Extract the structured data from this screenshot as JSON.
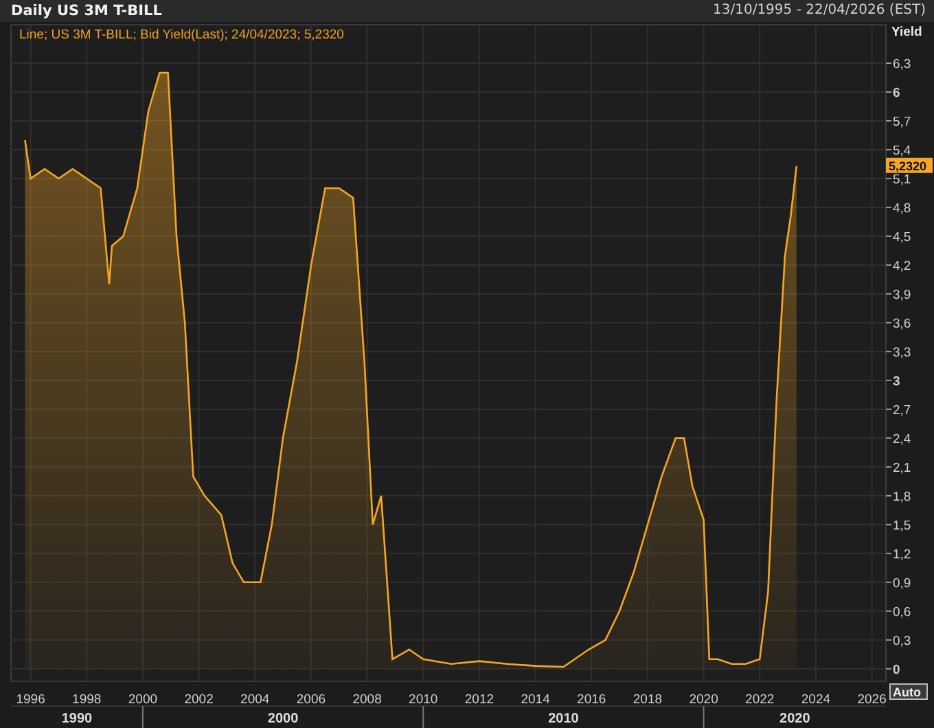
{
  "header": {
    "title": "Daily US 3M T-BILL",
    "date_range": "13/10/1995 - 22/04/2026 (EST)"
  },
  "chart": {
    "legend": "Line; US 3M T-BILL; Bid Yield(Last); 24/04/2023; 5,2320",
    "last_value_badge": "5,2320",
    "auto_button": "Auto",
    "decade_labels": [
      "1990",
      "2000",
      "2010",
      "2020"
    ],
    "chart_data": {
      "type": "area",
      "ylabel": "Yield",
      "grid": true,
      "x": [
        1995.8,
        1996.0,
        1996.5,
        1997.0,
        1997.5,
        1998.0,
        1998.5,
        1998.8,
        1998.9,
        1999.3,
        1999.8,
        2000.2,
        2000.6,
        2000.9,
        2001.2,
        2001.5,
        2001.8,
        2002.2,
        2002.8,
        2003.2,
        2003.6,
        2004.2,
        2004.6,
        2005.0,
        2005.5,
        2006.0,
        2006.5,
        2007.0,
        2007.5,
        2007.9,
        2008.2,
        2008.5,
        2008.9,
        2009.5,
        2010.0,
        2011.0,
        2012.0,
        2013.0,
        2014.0,
        2015.0,
        2015.9,
        2016.5,
        2017.0,
        2017.5,
        2018.0,
        2018.5,
        2019.0,
        2019.3,
        2019.6,
        2020.0,
        2020.2,
        2020.5,
        2021.0,
        2021.5,
        2022.0,
        2022.3,
        2022.6,
        2022.9,
        2023.1,
        2023.31
      ],
      "series": [
        {
          "color": "#f5a623",
          "values": [
            5.5,
            5.1,
            5.2,
            5.1,
            5.2,
            5.1,
            5.0,
            4.0,
            4.4,
            4.5,
            5.0,
            5.8,
            6.2,
            6.2,
            4.5,
            3.6,
            2.0,
            1.8,
            1.6,
            1.1,
            0.9,
            0.9,
            1.5,
            2.4,
            3.2,
            4.2,
            5.0,
            5.0,
            4.9,
            3.2,
            1.5,
            1.8,
            0.1,
            0.2,
            0.1,
            0.05,
            0.08,
            0.05,
            0.03,
            0.02,
            0.2,
            0.3,
            0.6,
            1.0,
            1.5,
            2.0,
            2.4,
            2.4,
            1.9,
            1.55,
            0.1,
            0.1,
            0.05,
            0.05,
            0.1,
            0.8,
            2.8,
            4.3,
            4.7,
            5.23
          ]
        }
      ],
      "xlim": [
        1995.3,
        2026.5
      ],
      "ylim": [
        -0.13,
        6.7
      ],
      "xticks": [
        {
          "value": 1996,
          "label": "1996"
        },
        {
          "value": 1998,
          "label": "1998"
        },
        {
          "value": 2000,
          "label": "2000"
        },
        {
          "value": 2002,
          "label": "2002"
        },
        {
          "value": 2004,
          "label": "2004"
        },
        {
          "value": 2006,
          "label": "2006"
        },
        {
          "value": 2008,
          "label": "2008"
        },
        {
          "value": 2010,
          "label": "2010"
        },
        {
          "value": 2012,
          "label": "2012"
        },
        {
          "value": 2014,
          "label": "2014"
        },
        {
          "value": 2016,
          "label": "2016"
        },
        {
          "value": 2018,
          "label": "2018"
        },
        {
          "value": 2020,
          "label": "2020"
        },
        {
          "value": 2022,
          "label": "2022"
        },
        {
          "value": 2024,
          "label": "2024"
        },
        {
          "value": 2026,
          "label": "2026"
        }
      ],
      "yticks": [
        {
          "value": 0,
          "label": "0"
        },
        {
          "value": 0.3,
          "label": "0,3"
        },
        {
          "value": 0.6,
          "label": "0,6"
        },
        {
          "value": 0.9,
          "label": "0,9"
        },
        {
          "value": 1.2,
          "label": "1,2"
        },
        {
          "value": 1.5,
          "label": "1,5"
        },
        {
          "value": 1.8,
          "label": "1,8"
        },
        {
          "value": 2.1,
          "label": "2,1"
        },
        {
          "value": 2.4,
          "label": "2,4"
        },
        {
          "value": 2.7,
          "label": "2,7"
        },
        {
          "value": 3,
          "label": "3"
        },
        {
          "value": 3.3,
          "label": "3,3"
        },
        {
          "value": 3.6,
          "label": "3,6"
        },
        {
          "value": 3.9,
          "label": "3,9"
        },
        {
          "value": 4.2,
          "label": "4,2"
        },
        {
          "value": 4.5,
          "label": "4,5"
        },
        {
          "value": 4.8,
          "label": "4,8"
        },
        {
          "value": 5.1,
          "label": "5,1"
        },
        {
          "value": 5.4,
          "label": "5,4"
        },
        {
          "value": 5.7,
          "label": "5,7"
        },
        {
          "value": 6,
          "label": "6"
        },
        {
          "value": 6.3,
          "label": "6,3"
        }
      ]
    }
  }
}
